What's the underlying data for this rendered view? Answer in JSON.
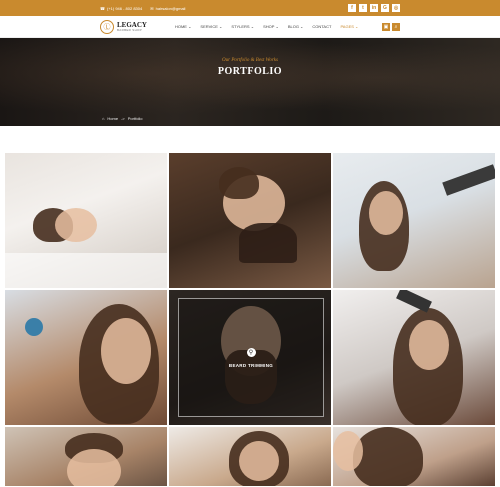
{
  "topbar": {
    "phone": "(+1) 946 - 802 8304",
    "email": "hairsalon@gmail",
    "social": [
      "f",
      "t",
      "in",
      "G",
      "◎"
    ]
  },
  "brand": {
    "name": "LEGACY",
    "tagline": "BARBER SHOP"
  },
  "menu": [
    {
      "label": "HOME ⌄",
      "active": false
    },
    {
      "label": "SERVICE ⌄",
      "active": false
    },
    {
      "label": "STYLERS ⌄",
      "active": false
    },
    {
      "label": "SHOP ⌄",
      "active": false
    },
    {
      "label": "BLOG ⌄",
      "active": false
    },
    {
      "label": "CONTACT",
      "active": false
    },
    {
      "label": "PAGES ⌄",
      "active": true
    }
  ],
  "hero": {
    "subtitle": "Our Portfolio & Best Works",
    "title": "PORTFOLIO",
    "breadcrumb": {
      "home": "Home",
      "separator": "->",
      "current": "Portfolio"
    }
  },
  "gallery": {
    "overlay_caption": "BEARD TRIMMING"
  },
  "colors": {
    "accent": "#c98a2e"
  }
}
